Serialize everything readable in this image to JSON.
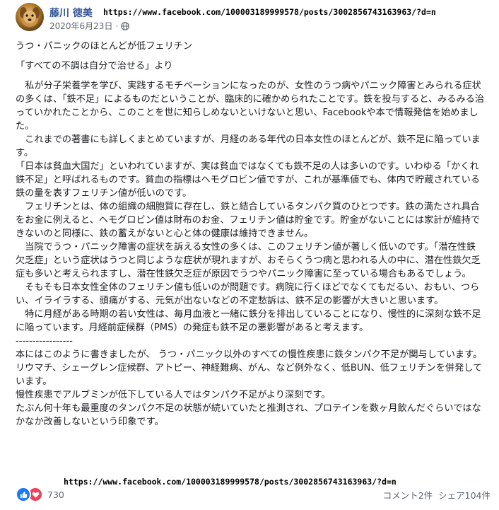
{
  "post": {
    "author": "藤川 徳美",
    "url": "https://www.facebook.com/100003189999578/posts/3002856743163963/?d=n",
    "date": "2020年6月23日",
    "globe_icon": "globe-icon",
    "paragraphs": [
      "うつ・パニックのほとんどが低フェリチン",
      "「すべての不調は自分で治せる」より",
      "　私が分子栄養学を学び、実践するモチベーションになったのが、女性のうつ病やパニック障害とみられる症状の多くは、「鉄不足」によるものだということが、臨床的に確かめられたことです。鉄を投与すると、みるみる治っていかれたことから、このことを世に知らしめないといけないと思い、Facebookや本で情報発信を始めました。\n　これまでの著書にも詳しくまとめていますが、月経のある年代の日本女性のほとんどが、鉄不足に陥っています。\n「日本は貧血大国だ」といわれていますが、実は貧血ではなくても鉄不足の人は多いのです。いわゆる「かくれ鉄不足」と呼ばれるものです。貧血の指標はヘモグロビン値ですが、これが基準値でも、体内で貯蔵されている鉄の量を表すフェリチン値が低いのです。\n　フェリチンとは、体の組織の細胞質に存在し、鉄と結合しているタンパク質のひとつです。鉄の満たされ具合をお金に例えると、ヘモグロビン値は財布のお金、フェリチン値は貯金です。貯金がないことには家計が維持できないのと同様に、鉄の蓄えがないと心と体の健康は維持できません。\n　当院でうつ・パニック障害の症状を訴える女性の多くは、このフェリチン値が著しく低いのです。「潜在性鉄欠乏症」という症状はうつと同じような症状が現れますが、おそらくうつ病と思われる人の中に、潜在性鉄欠乏症も多いと考えられますし、潜在性鉄欠乏症が原因でうつやパニック障害に至っている場合もあるでしょう。\n　そもそも日本女性全体のフェリチン値も低いのが問題です。病院に行くほどでなくてもだるい、おもい、つらい、イライラする、頭痛がする、元気が出ないなどの不定愁訴は、鉄不足の影響が大きいと思います。\n　特に月経がある時期の若い女性は、毎月血液と一緒に鉄分を排出していることになり、慢性的に深刻な鉄不足に陥っています。月経前症候群（PMS）の発症も鉄不足の悪影響があると考えます。\n-----------------\n本にはこのように書きましたが、 うつ・パニック以外のすべての慢性疾患に鉄タンパク不足が関与しています。\nリウマチ、シェーグレン症候群、アトピー、神経難病、がん、など例外なく、低BUN、低フェリチンを併発しています。\n慢性疾患でアルブミンが低下している人ではタンパク不足がより深刻です。\nたぶん何十年も最重度のタンパク不足の状態が続いていたと推測され、プロテインを数ヶ月飲んだぐらいではなかなか改善しないという印象です。"
    ]
  },
  "footer": {
    "reaction_icons": [
      "like-icon",
      "love-icon"
    ],
    "reaction_count": "730",
    "url": "https://www.facebook.com/100003189999578/posts/3002856743163963/?d=n",
    "comments": "コメント2件",
    "shares": "シェア104件"
  },
  "colors": {
    "author": "#385898",
    "meta": "#616770",
    "like": "#1877f2",
    "love": "#f33e58"
  }
}
